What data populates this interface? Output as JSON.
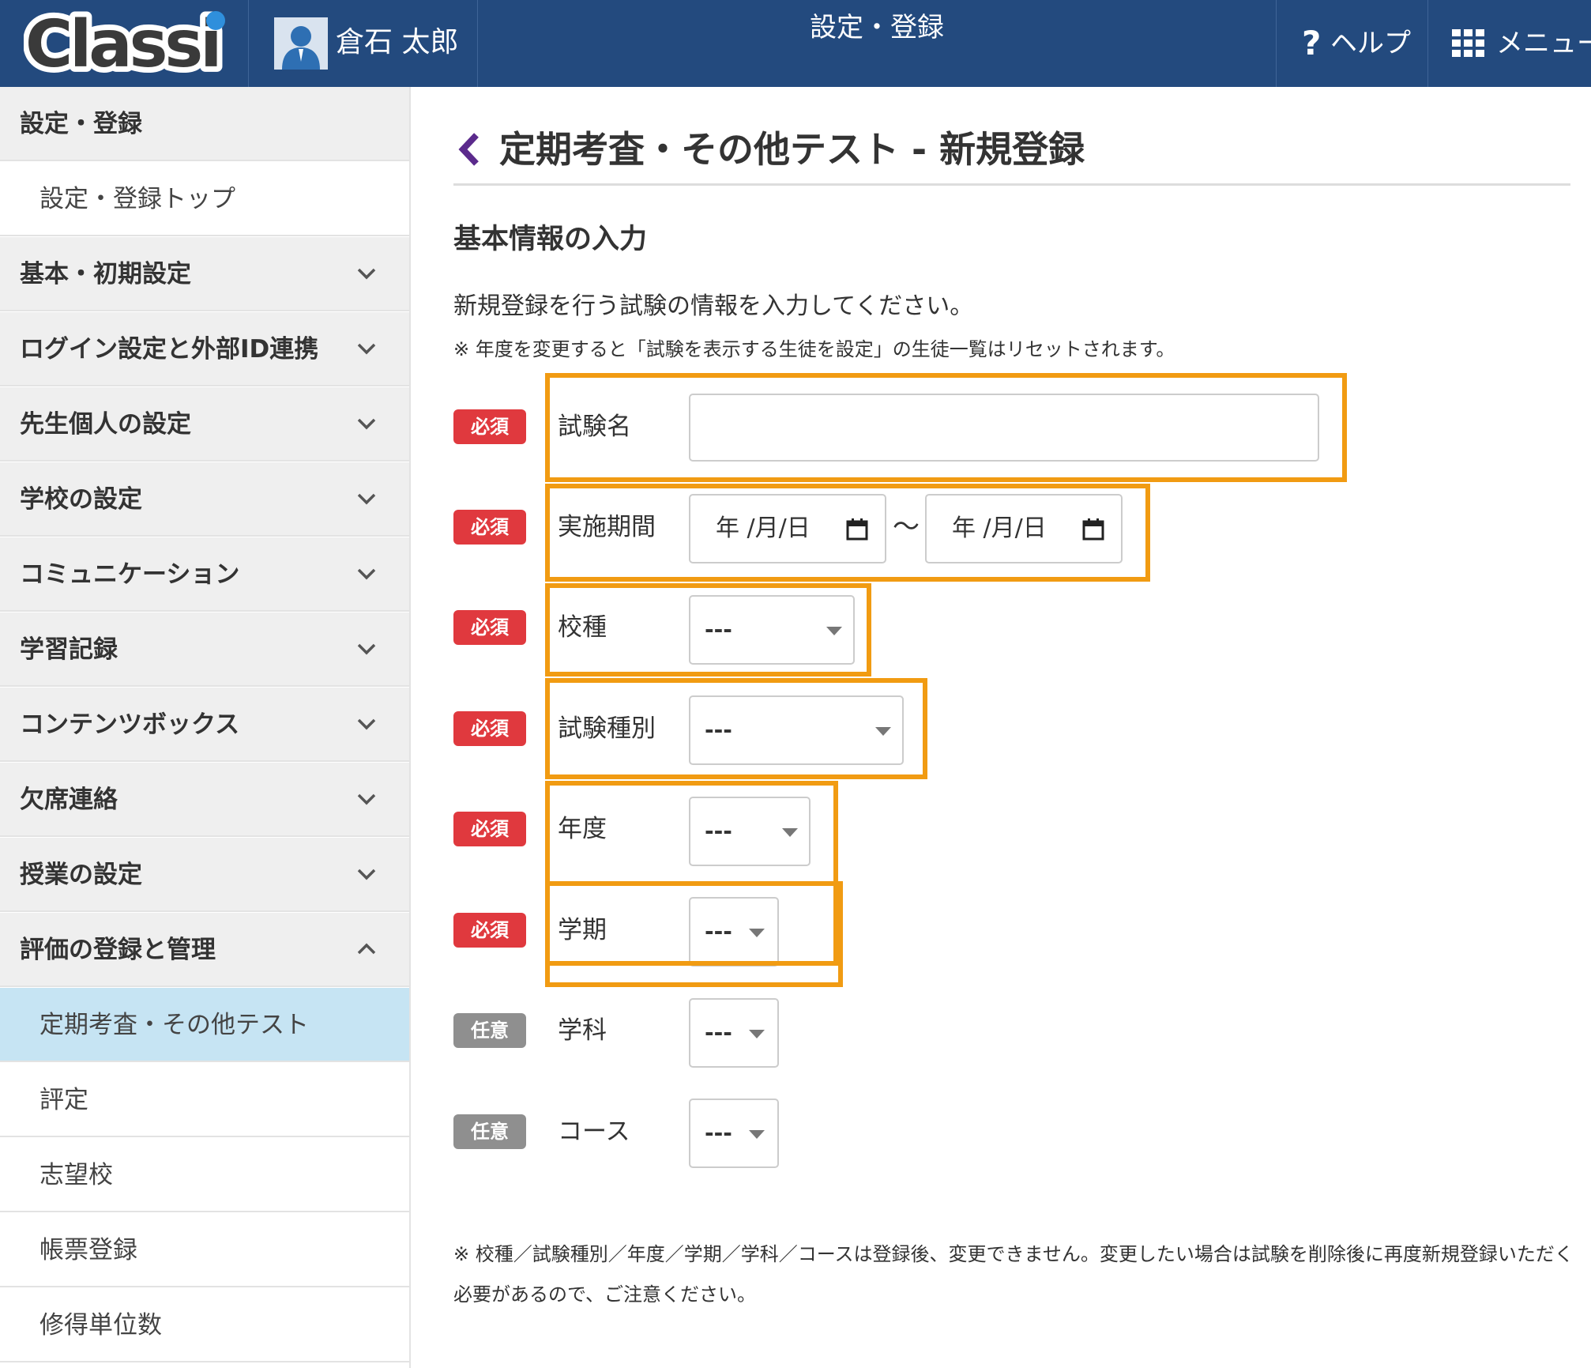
{
  "header": {
    "logo_text": "Classi",
    "user_name": "倉石 太郎",
    "title": "設定・登録",
    "help_label": "ヘルプ",
    "menu_label": "メニュー"
  },
  "sidebar": {
    "items": [
      {
        "label": "設定・登録",
        "type": "section"
      },
      {
        "label": "設定・登録トップ",
        "type": "sub"
      },
      {
        "label": "基本・初期設定",
        "type": "section",
        "chevron": "chevron-down-icon"
      },
      {
        "label": "ログイン設定と外部ID連携",
        "type": "section",
        "chevron": "chevron-down-icon"
      },
      {
        "label": "先生個人の設定",
        "type": "section",
        "chevron": "chevron-down-icon"
      },
      {
        "label": "学校の設定",
        "type": "section",
        "chevron": "chevron-down-icon"
      },
      {
        "label": "コミュニケーション",
        "type": "section",
        "chevron": "chevron-down-icon"
      },
      {
        "label": "学習記録",
        "type": "section",
        "chevron": "chevron-down-icon"
      },
      {
        "label": "コンテンツボックス",
        "type": "section",
        "chevron": "chevron-down-icon"
      },
      {
        "label": "欠席連絡",
        "type": "section",
        "chevron": "chevron-down-icon"
      },
      {
        "label": "授業の設定",
        "type": "section",
        "chevron": "chevron-down-icon"
      },
      {
        "label": "評価の登録と管理",
        "type": "section",
        "chevron": "chevron-up-icon"
      },
      {
        "label": "定期考査・その他テスト",
        "type": "sub",
        "active": true
      },
      {
        "label": "評定",
        "type": "sub"
      },
      {
        "label": "志望校",
        "type": "sub"
      },
      {
        "label": "帳票登録",
        "type": "sub"
      },
      {
        "label": "修得単位数",
        "type": "sub"
      }
    ]
  },
  "main": {
    "page_title": "定期考査・その他テスト - 新規登録",
    "section_title": "基本情報の入力",
    "intro": "新規登録を行う試験の情報を入力してください。",
    "note_top": "※ 年度を変更すると「試験を表示する生徒を設定」の生徒一覧はリセットされます。",
    "badges": {
      "required": "必須",
      "optional": "任意"
    },
    "fields": {
      "exam_name": {
        "label": "試験名",
        "value": ""
      },
      "period": {
        "label": "実施期間",
        "start": "年 /月/日",
        "end": "年 /月/日",
        "separator": "〜"
      },
      "school_type": {
        "label": "校種",
        "value": "---"
      },
      "exam_type": {
        "label": "試験種別",
        "value": "---"
      },
      "fiscal_year": {
        "label": "年度",
        "value": "---"
      },
      "term": {
        "label": "学期",
        "value": "---"
      },
      "department": {
        "label": "学科",
        "value": "---"
      },
      "course": {
        "label": "コース",
        "value": "---"
      }
    },
    "note_bottom": "※ 校種／試験種別／年度／学期／学科／コースは登録後、変更できません。変更したい場合は試験を削除後に再度新規登録いただく必要があるので、ご注意ください。"
  },
  "colors": {
    "header_bg": "#234a7e",
    "required_badge": "#e0393e",
    "optional_badge": "#8f8f8f",
    "highlight": "#f19b12",
    "active_nav": "#c6e4f3",
    "back_icon": "#5b2a8c"
  }
}
